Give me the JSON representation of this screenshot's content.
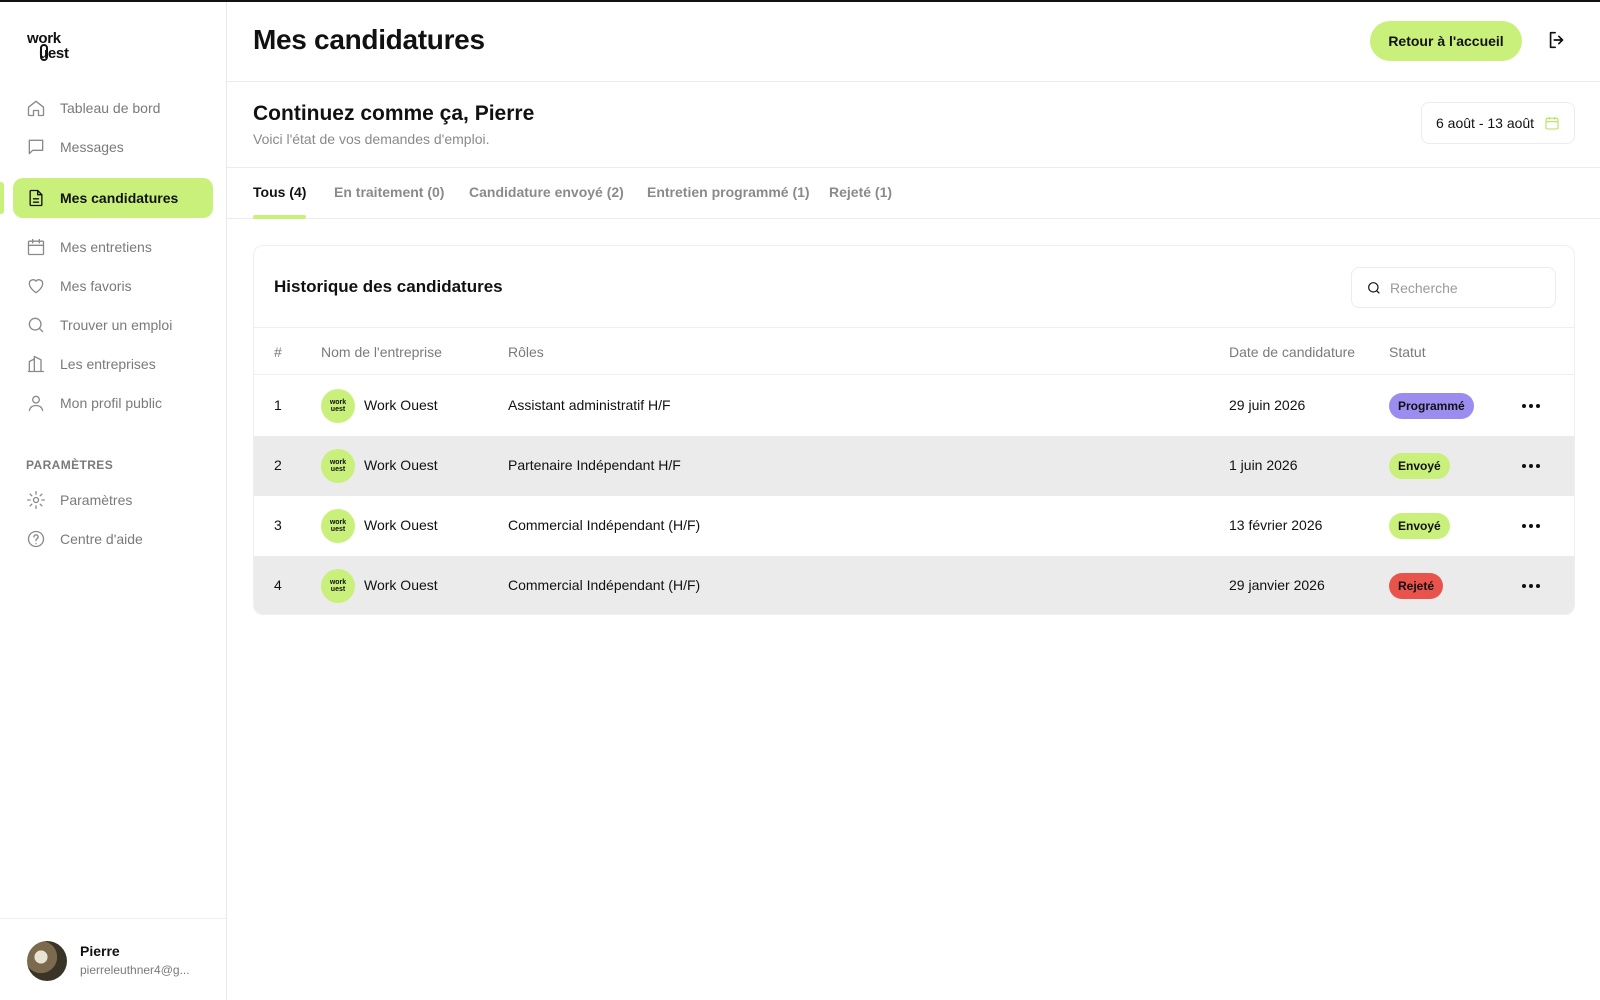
{
  "app": {
    "logo_top": "work",
    "logo_bottom": "uest"
  },
  "sidebar": {
    "items": [
      {
        "label": "Tableau de bord",
        "icon": "home-icon"
      },
      {
        "label": "Messages",
        "icon": "message-icon"
      },
      {
        "label": "Mes candidatures",
        "icon": "document-icon",
        "active": true
      },
      {
        "label": "Mes entretiens",
        "icon": "calendar-icon"
      },
      {
        "label": "Mes favoris",
        "icon": "heart-icon"
      },
      {
        "label": "Trouver un emploi",
        "icon": "search-icon"
      },
      {
        "label": "Les entreprises",
        "icon": "building-icon"
      },
      {
        "label": "Mon profil public",
        "icon": "user-icon"
      }
    ],
    "settings_label": "PARAMÈTRES",
    "settings_items": [
      {
        "label": "Paramètres",
        "icon": "gear-icon"
      },
      {
        "label": "Centre d'aide",
        "icon": "help-icon"
      }
    ],
    "user": {
      "name": "Pierre",
      "email": "pierreleuthner4@g..."
    }
  },
  "header": {
    "title": "Mes candidatures",
    "home_button": "Retour à l'accueil"
  },
  "greeting": {
    "title": "Continuez comme ça, Pierre",
    "subtitle": "Voici l'état de vos demandes d'emploi.",
    "date_range": "6 août - 13 août"
  },
  "tabs": [
    {
      "label": "Tous (4)",
      "active": true
    },
    {
      "label": "En traitement (0)"
    },
    {
      "label": "Candidature envoyé (2)"
    },
    {
      "label": "Entretien programmé (1)"
    },
    {
      "label": "Rejeté (1)"
    }
  ],
  "history": {
    "title": "Historique des candidatures",
    "search_placeholder": "Recherche",
    "columns": [
      "#",
      "Nom de l'entreprise",
      "Rôles",
      "Date de candidature",
      "Statut"
    ],
    "rows": [
      {
        "num": "1",
        "company": "Work Ouest",
        "role": "Assistant administratif H/F",
        "date": "29 juin 2026",
        "status": "Programmé",
        "status_color": "#9b8cf0"
      },
      {
        "num": "2",
        "company": "Work Ouest",
        "role": "Partenaire Indépendant H/F",
        "date": "1 juin 2026",
        "status": "Envoyé",
        "status_color": "#c9f07a"
      },
      {
        "num": "3",
        "company": "Work Ouest",
        "role": "Commercial Indépendant (H/F)",
        "date": "13 février 2026",
        "status": "Envoyé",
        "status_color": "#c9f07a"
      },
      {
        "num": "4",
        "company": "Work Ouest",
        "role": "Commercial Indépendant (H/F)",
        "date": "29 janvier 2026",
        "status": "Rejeté",
        "status_color": "#e8544c"
      }
    ]
  },
  "colors": {
    "accent": "#c9f07a",
    "scheduled": "#9b8cf0",
    "rejected": "#e8544c"
  }
}
